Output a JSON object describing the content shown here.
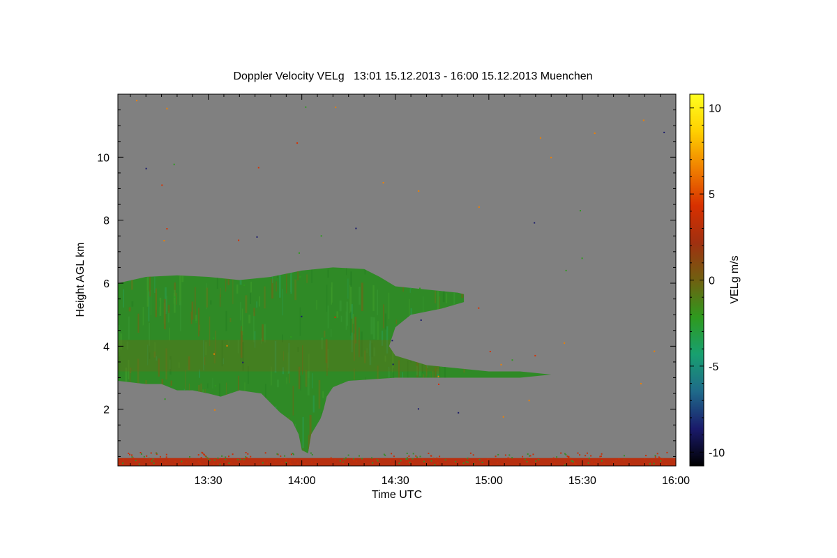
{
  "chart_data": {
    "type": "heatmap",
    "title": "Doppler Velocity VELg   13:01 15.12.2013 - 16:00 15.12.2013 Muenchen",
    "xlabel": "Time UTC",
    "ylabel": "Height AGL km",
    "x_range": [
      "13:01",
      "16:00"
    ],
    "x_ticks": [
      "13:30",
      "14:00",
      "14:30",
      "15:00",
      "15:30",
      "16:00"
    ],
    "x_tick_minutes": [
      30,
      60,
      90,
      120,
      150,
      180
    ],
    "y_range": [
      0.2,
      12.0
    ],
    "y_ticks": [
      "2",
      "4",
      "6",
      "8",
      "10"
    ],
    "y_tick_values": [
      2,
      4,
      6,
      8,
      10
    ],
    "grid": false,
    "background_color": "#808080",
    "colorbar": {
      "label": "VELg m/s",
      "range": [
        -10.8,
        10.8
      ],
      "ticks": [
        "10",
        "5",
        "0",
        "-5",
        "-10"
      ],
      "tick_values": [
        10,
        5,
        0,
        -5,
        -10
      ],
      "colors": [
        "#000000",
        "#1a1a6b",
        "#1f6a8a",
        "#18a070",
        "#2e9a1e",
        "#706010",
        "#a03010",
        "#d83000",
        "#f08000",
        "#ffd000",
        "#ffff20"
      ]
    },
    "cloud_main": {
      "description_values": "echo region, time in minutes after 13:00, height in km",
      "top": [
        [
          1,
          6.0
        ],
        [
          10,
          6.2
        ],
        [
          20,
          6.25
        ],
        [
          30,
          6.2
        ],
        [
          40,
          6.1
        ],
        [
          50,
          6.2
        ],
        [
          60,
          6.4
        ],
        [
          70,
          6.5
        ],
        [
          80,
          6.45
        ],
        [
          85,
          6.2
        ],
        [
          90,
          5.9
        ],
        [
          100,
          5.8
        ],
        [
          110,
          5.7
        ],
        [
          112,
          5.65
        ]
      ],
      "bottom": [
        [
          112,
          5.4
        ],
        [
          105,
          5.2
        ],
        [
          100,
          5.1
        ],
        [
          95,
          5.0
        ],
        [
          90,
          4.6
        ],
        [
          88,
          4.0
        ],
        [
          90,
          3.7
        ],
        [
          100,
          3.4
        ],
        [
          110,
          3.3
        ],
        [
          120,
          3.2
        ],
        [
          130,
          3.2
        ],
        [
          140,
          3.1
        ],
        [
          130,
          3.0
        ],
        [
          110,
          3.0
        ],
        [
          90,
          3.0
        ],
        [
          75,
          2.9
        ],
        [
          70,
          2.7
        ],
        [
          68,
          2.4
        ],
        [
          67,
          2.0
        ],
        [
          66,
          1.7
        ],
        [
          63,
          1.2
        ],
        [
          62,
          0.6
        ],
        [
          60,
          0.7
        ],
        [
          59,
          1.2
        ],
        [
          57,
          1.6
        ],
        [
          53,
          1.9
        ],
        [
          50,
          2.2
        ],
        [
          47,
          2.5
        ],
        [
          40,
          2.6
        ],
        [
          34,
          2.4
        ],
        [
          30,
          2.5
        ],
        [
          25,
          2.6
        ],
        [
          20,
          2.6
        ],
        [
          15,
          2.8
        ],
        [
          10,
          2.8
        ],
        [
          1,
          2.9
        ]
      ],
      "velocity_ms": -1.5
    },
    "near_ground_layer": {
      "height_range_km": [
        0.2,
        0.65
      ],
      "velocity_ms": 2.5
    }
  }
}
